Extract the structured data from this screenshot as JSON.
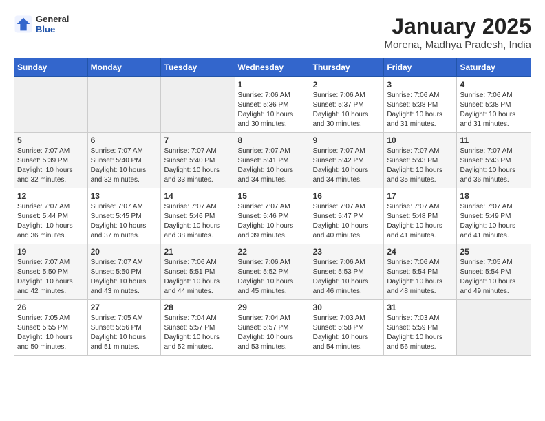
{
  "header": {
    "logo_general": "General",
    "logo_blue": "Blue",
    "month_title": "January 2025",
    "location": "Morena, Madhya Pradesh, India"
  },
  "weekdays": [
    "Sunday",
    "Monday",
    "Tuesday",
    "Wednesday",
    "Thursday",
    "Friday",
    "Saturday"
  ],
  "weeks": [
    [
      {
        "day": "",
        "empty": true
      },
      {
        "day": "",
        "empty": true
      },
      {
        "day": "",
        "empty": true
      },
      {
        "day": "1",
        "sunrise": "7:06 AM",
        "sunset": "5:36 PM",
        "daylight": "10 hours and 30 minutes."
      },
      {
        "day": "2",
        "sunrise": "7:06 AM",
        "sunset": "5:37 PM",
        "daylight": "10 hours and 30 minutes."
      },
      {
        "day": "3",
        "sunrise": "7:06 AM",
        "sunset": "5:38 PM",
        "daylight": "10 hours and 31 minutes."
      },
      {
        "day": "4",
        "sunrise": "7:06 AM",
        "sunset": "5:38 PM",
        "daylight": "10 hours and 31 minutes."
      }
    ],
    [
      {
        "day": "5",
        "sunrise": "7:07 AM",
        "sunset": "5:39 PM",
        "daylight": "10 hours and 32 minutes."
      },
      {
        "day": "6",
        "sunrise": "7:07 AM",
        "sunset": "5:40 PM",
        "daylight": "10 hours and 32 minutes."
      },
      {
        "day": "7",
        "sunrise": "7:07 AM",
        "sunset": "5:40 PM",
        "daylight": "10 hours and 33 minutes."
      },
      {
        "day": "8",
        "sunrise": "7:07 AM",
        "sunset": "5:41 PM",
        "daylight": "10 hours and 34 minutes."
      },
      {
        "day": "9",
        "sunrise": "7:07 AM",
        "sunset": "5:42 PM",
        "daylight": "10 hours and 34 minutes."
      },
      {
        "day": "10",
        "sunrise": "7:07 AM",
        "sunset": "5:43 PM",
        "daylight": "10 hours and 35 minutes."
      },
      {
        "day": "11",
        "sunrise": "7:07 AM",
        "sunset": "5:43 PM",
        "daylight": "10 hours and 36 minutes."
      }
    ],
    [
      {
        "day": "12",
        "sunrise": "7:07 AM",
        "sunset": "5:44 PM",
        "daylight": "10 hours and 36 minutes."
      },
      {
        "day": "13",
        "sunrise": "7:07 AM",
        "sunset": "5:45 PM",
        "daylight": "10 hours and 37 minutes."
      },
      {
        "day": "14",
        "sunrise": "7:07 AM",
        "sunset": "5:46 PM",
        "daylight": "10 hours and 38 minutes."
      },
      {
        "day": "15",
        "sunrise": "7:07 AM",
        "sunset": "5:46 PM",
        "daylight": "10 hours and 39 minutes."
      },
      {
        "day": "16",
        "sunrise": "7:07 AM",
        "sunset": "5:47 PM",
        "daylight": "10 hours and 40 minutes."
      },
      {
        "day": "17",
        "sunrise": "7:07 AM",
        "sunset": "5:48 PM",
        "daylight": "10 hours and 41 minutes."
      },
      {
        "day": "18",
        "sunrise": "7:07 AM",
        "sunset": "5:49 PM",
        "daylight": "10 hours and 41 minutes."
      }
    ],
    [
      {
        "day": "19",
        "sunrise": "7:07 AM",
        "sunset": "5:50 PM",
        "daylight": "10 hours and 42 minutes."
      },
      {
        "day": "20",
        "sunrise": "7:07 AM",
        "sunset": "5:50 PM",
        "daylight": "10 hours and 43 minutes."
      },
      {
        "day": "21",
        "sunrise": "7:06 AM",
        "sunset": "5:51 PM",
        "daylight": "10 hours and 44 minutes."
      },
      {
        "day": "22",
        "sunrise": "7:06 AM",
        "sunset": "5:52 PM",
        "daylight": "10 hours and 45 minutes."
      },
      {
        "day": "23",
        "sunrise": "7:06 AM",
        "sunset": "5:53 PM",
        "daylight": "10 hours and 46 minutes."
      },
      {
        "day": "24",
        "sunrise": "7:06 AM",
        "sunset": "5:54 PM",
        "daylight": "10 hours and 48 minutes."
      },
      {
        "day": "25",
        "sunrise": "7:05 AM",
        "sunset": "5:54 PM",
        "daylight": "10 hours and 49 minutes."
      }
    ],
    [
      {
        "day": "26",
        "sunrise": "7:05 AM",
        "sunset": "5:55 PM",
        "daylight": "10 hours and 50 minutes."
      },
      {
        "day": "27",
        "sunrise": "7:05 AM",
        "sunset": "5:56 PM",
        "daylight": "10 hours and 51 minutes."
      },
      {
        "day": "28",
        "sunrise": "7:04 AM",
        "sunset": "5:57 PM",
        "daylight": "10 hours and 52 minutes."
      },
      {
        "day": "29",
        "sunrise": "7:04 AM",
        "sunset": "5:57 PM",
        "daylight": "10 hours and 53 minutes."
      },
      {
        "day": "30",
        "sunrise": "7:03 AM",
        "sunset": "5:58 PM",
        "daylight": "10 hours and 54 minutes."
      },
      {
        "day": "31",
        "sunrise": "7:03 AM",
        "sunset": "5:59 PM",
        "daylight": "10 hours and 56 minutes."
      },
      {
        "day": "",
        "empty": true
      }
    ]
  ]
}
